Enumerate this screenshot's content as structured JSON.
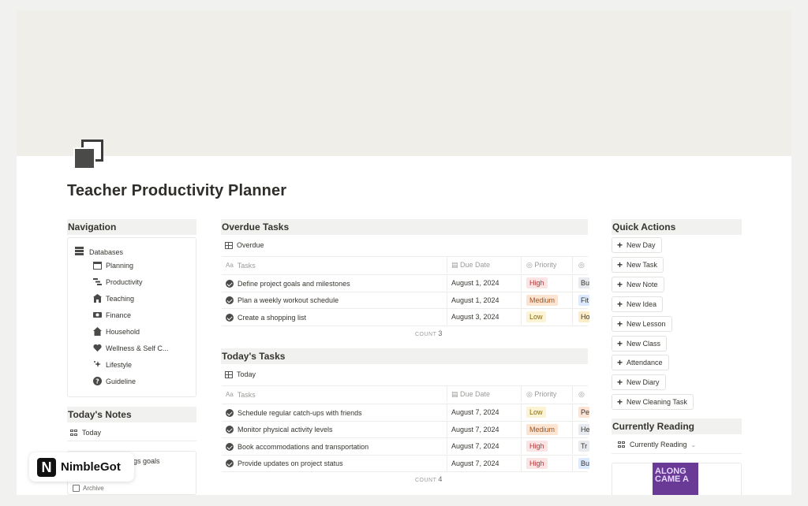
{
  "page": {
    "title": "Teacher Productivity Planner"
  },
  "navigation": {
    "header": "Navigation",
    "databases_label": "Databases",
    "items": [
      {
        "label": "Planning",
        "icon": "calendar-icon"
      },
      {
        "label": "Productivity",
        "icon": "timeline-icon"
      },
      {
        "label": "Teaching",
        "icon": "school-icon"
      },
      {
        "label": "Finance",
        "icon": "money-icon"
      },
      {
        "label": "Household",
        "icon": "house-icon"
      },
      {
        "label": "Wellness & Self C...",
        "icon": "heart-icon"
      },
      {
        "label": "Lifestyle",
        "icon": "sparkles-icon"
      },
      {
        "label": "Guideline",
        "icon": "question-icon"
      }
    ]
  },
  "notes": {
    "header": "Today's Notes",
    "view_label": "Today",
    "partial_item": "gs goals",
    "archive_label": "Archive"
  },
  "overdue": {
    "header": "Overdue Tasks",
    "view_label": "Overdue",
    "columns": {
      "tasks": "Tasks",
      "due": "Due Date",
      "priority": "Priority"
    },
    "rows": [
      {
        "task": "Define project goals and milestones",
        "due": "August 1, 2024",
        "priority": "High",
        "category": "Bu"
      },
      {
        "task": "Plan a weekly workout schedule",
        "due": "August 1, 2024",
        "priority": "Medium",
        "category": "Fit"
      },
      {
        "task": "Create a shopping list",
        "due": "August 3, 2024",
        "priority": "Low",
        "category": "Ho"
      }
    ],
    "count_label": "COUNT",
    "count": "3"
  },
  "today": {
    "header": "Today's Tasks",
    "view_label": "Today",
    "columns": {
      "tasks": "Tasks",
      "due": "Due Date",
      "priority": "Priority"
    },
    "rows": [
      {
        "task": "Schedule regular catch-ups with friends",
        "due": "August 7, 2024",
        "priority": "Low",
        "category": "Pe"
      },
      {
        "task": "Monitor physical activity levels",
        "due": "August 7, 2024",
        "priority": "Medium",
        "category": "He"
      },
      {
        "task": "Book accommodations and transportation",
        "due": "August 7, 2024",
        "priority": "High",
        "category": "Tr"
      },
      {
        "task": "Provide updates on project status",
        "due": "August 7, 2024",
        "priority": "High",
        "category": "Bu"
      }
    ],
    "count_label": "COUNT",
    "count": "4"
  },
  "quick_actions": {
    "header": "Quick Actions",
    "buttons": [
      "New Day",
      "New Task",
      "New Note",
      "New Idea",
      "New Lesson",
      "New Class",
      "Attendance",
      "New Diary",
      "New Cleaning Task"
    ]
  },
  "reading": {
    "header": "Currently Reading",
    "view_label": "Currently Reading",
    "book_cover_text": "ALONG CAME A"
  },
  "watermark": {
    "mark": "N",
    "text": "NimbleGot"
  },
  "colors": {
    "high": "#fbe4e4",
    "high_text": "#b3373a",
    "medium": "#fbe4d2",
    "medium_text": "#a5521f",
    "low": "#fbf3d3",
    "low_text": "#8a6a0f"
  }
}
